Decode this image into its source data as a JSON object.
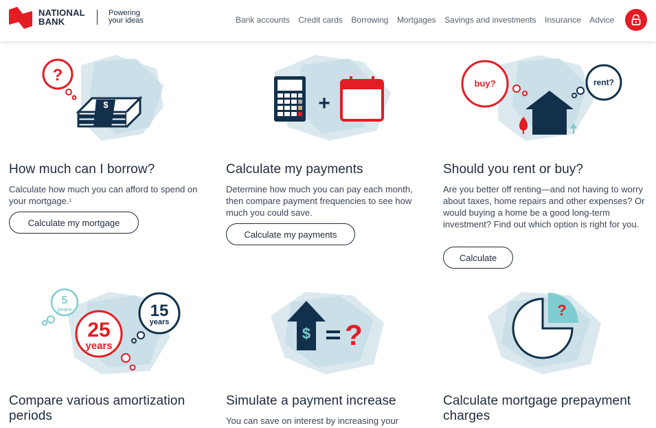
{
  "header": {
    "brand_line1": "NATIONAL",
    "brand_line2": "BANK",
    "tagline_line1": "Powering",
    "tagline_line2": "your ideas",
    "nav": [
      "Bank accounts",
      "Credit cards",
      "Borrowing",
      "Mortgages",
      "Savings and investments",
      "Insurance",
      "Advice"
    ],
    "lock_icon": "lock-icon",
    "brand_color": "#e41c23"
  },
  "cards": [
    {
      "title": "How much can I borrow?",
      "text": "Calculate how much you can afford to spend on your mortgage.",
      "footnote": "1",
      "button": "Calculate my mortgage",
      "icon": "money-stack-question-icon"
    },
    {
      "title": "Calculate my payments",
      "text": "Determine how much you can pay each month, then compare payment frequencies to see how much you could save.",
      "button": "Calculate my payments",
      "icon": "calculator-calendar-icon"
    },
    {
      "title": "Should you rent or buy?",
      "text": "Are you better off renting—and not having to worry about taxes, home repairs and other expenses? Or would buying a home be a good long-term investment? Find out which option is right for you.",
      "button": "Calculate",
      "icon": "house-rent-buy-icon",
      "bubble_buy": "buy?",
      "bubble_rent": "rent?"
    },
    {
      "title": "Compare various amortization periods",
      "icon": "amortization-years-icon",
      "bubble_5": "5",
      "bubble_5_unit": "years",
      "bubble_25": "25",
      "bubble_25_unit": "years",
      "bubble_15": "15",
      "bubble_15_unit": "years"
    },
    {
      "title": "Simulate a payment increase",
      "text": "You can save on interest by increasing your",
      "icon": "payment-increase-icon"
    },
    {
      "title": "Calculate mortgage prepayment charges",
      "icon": "pie-chart-question-icon"
    }
  ]
}
